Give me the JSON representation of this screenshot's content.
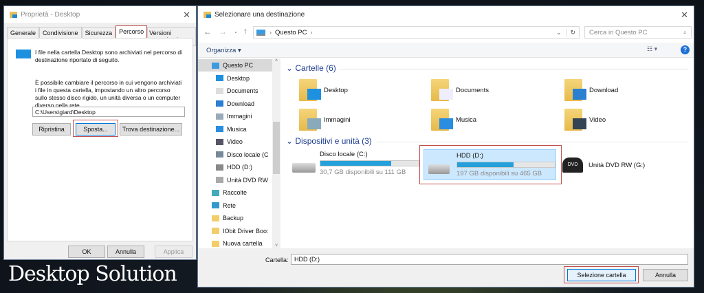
{
  "watermark": "Desktop Solution",
  "props": {
    "title": "Proprietà - Desktop",
    "tabs": [
      "Generale",
      "Condivisione",
      "Sicurezza",
      "Percorso",
      "Versioni precedenti"
    ],
    "active_tab": "Percorso",
    "info": "I file nella cartella Desktop sono archiviati nel percorso di destinazione riportato di seguito.",
    "desc": "È possibile cambiare il percorso in cui vengono archiviati i file in questa cartella, impostando un altro percorso sullo stesso disco rigido, un unità diversa o un computer diverso nella rete.",
    "path_value": "C:\\Users\\giard\\Desktop",
    "restore": "Ripristina",
    "move": "Sposta...",
    "find": "Trova destinazione...",
    "ok": "OK",
    "cancel": "Annulla",
    "apply": "Applica"
  },
  "picker": {
    "title": "Selezionare una destinazione",
    "breadcrumb": "Questo PC",
    "search_placeholder": "Cerca in Questo PC",
    "organize": "Organizza",
    "nav": [
      "Questo PC",
      "Desktop",
      "Documents",
      "Download",
      "Immagini",
      "Musica",
      "Video",
      "Disco locale (C",
      "HDD (D:)",
      "Unità DVD RW",
      "Raccolte",
      "Rete",
      "Backup",
      "IObit Driver Boo:",
      "Nuova cartella"
    ],
    "folders_header": "Cartelle (6)",
    "folders": [
      "Desktop",
      "Documents",
      "Download",
      "Immagini",
      "Musica",
      "Video"
    ],
    "devices_header": "Dispositivi e unità (3)",
    "devices": [
      {
        "name": "Disco locale (C:)",
        "info": "30,7 GB disponibili su 111 GB",
        "used_fraction": 0.72
      },
      {
        "name": "HDD (D:)",
        "info": "197 GB disponibili su 465 GB",
        "used_fraction": 0.58
      },
      {
        "name": "Unità DVD RW (G:)"
      }
    ],
    "folder_label": "Cartella:",
    "folder_value": "HDD (D:)",
    "select": "Selezione cartella",
    "cancel": "Annulla"
  },
  "colors": {
    "accent": "#26a0da",
    "highlight": "#c0504d",
    "selected": "#cce8ff"
  }
}
